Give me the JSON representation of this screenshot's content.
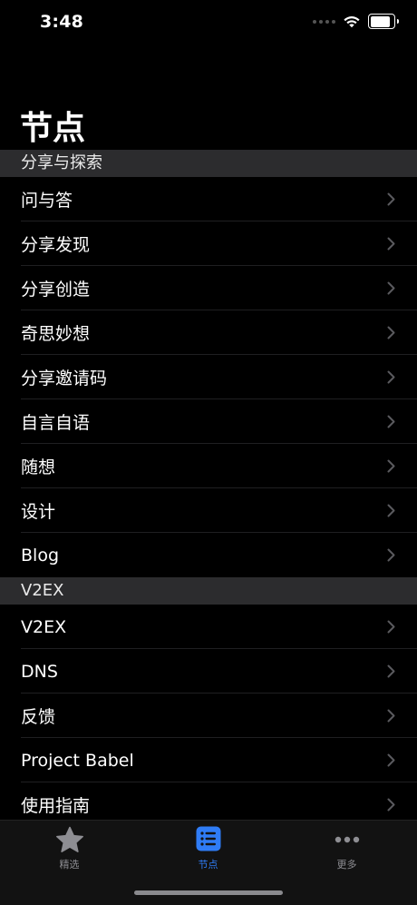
{
  "status_bar": {
    "time": "3:48"
  },
  "page_title": "节点",
  "sections": [
    {
      "header": "分享与探索",
      "items": [
        "问与答",
        "分享发现",
        "分享创造",
        "奇思妙想",
        "分享邀请码",
        "自言自语",
        "随想",
        "设计",
        "Blog"
      ]
    },
    {
      "header": "V2EX",
      "items": [
        "V2EX",
        "DNS",
        "反馈",
        "Project Babel",
        "使用指南"
      ]
    }
  ],
  "tab_bar": {
    "tabs": [
      {
        "label": "精选",
        "icon": "star-icon",
        "active": false
      },
      {
        "label": "节点",
        "icon": "list-icon",
        "active": true
      },
      {
        "label": "更多",
        "icon": "more-icon",
        "active": false
      }
    ]
  },
  "colors": {
    "background": "#000000",
    "section_header_bg": "#2c2c2e",
    "accent": "#2f7cf6",
    "inactive_tab": "#8e8e93"
  }
}
